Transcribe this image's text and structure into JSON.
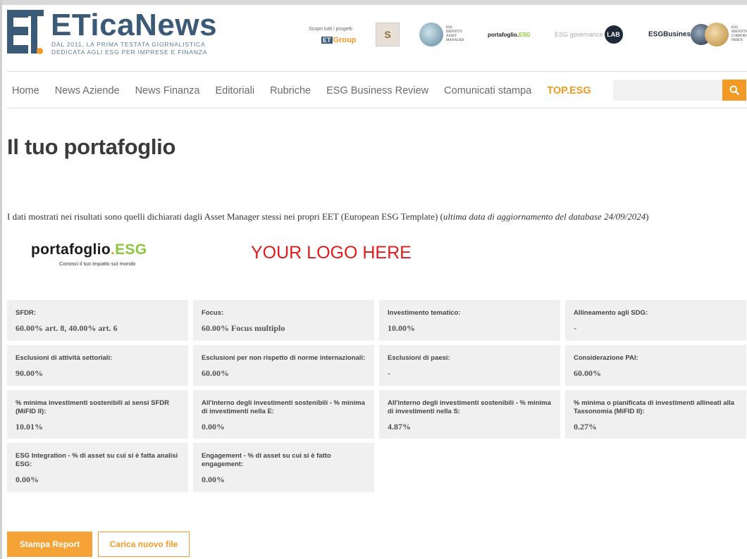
{
  "header": {
    "brand": "ETicaNews",
    "tagline_line1": "DAL 2011, LA PRIMA TESTATA GIORNALISTICA",
    "tagline_line2": "DEDICATA AGLI ESG PER IMPRESE E FINANZA",
    "partners_caption": "Scopri tutti i progetti",
    "etgroup_mark": "ET",
    "etgroup_text": "Group",
    "partner_portafoglio_prefix": "portafoglio.",
    "partner_portafoglio_suffix": "ESG",
    "partner_governance_text": "ESG governance",
    "partner_governance_lab": "LAB",
    "partner_esgbusiness": "ESGBusiness"
  },
  "nav": {
    "items": [
      "Home",
      "News Aziende",
      "News Finanza",
      "Editoriali",
      "Rubriche",
      "ESG Business Review",
      "Comunicati stampa",
      "TOP.ESG"
    ]
  },
  "search": {
    "placeholder": ""
  },
  "main": {
    "title": "Il tuo portafoglio",
    "intro_text": "I dati mostrati nei risultati sono quelli dichiarati dagli Asset Manager stessi nei propri EET (European ESG Template) (",
    "intro_italic": "ultima data di aggiornamento del database 24/09/2024",
    "intro_end": ")",
    "pf_logo_name": "portafoglio",
    "pf_logo_dot": ".",
    "pf_logo_esg": "ESG",
    "pf_logo_sub": "Conosci il tuo impatto sul mondo",
    "your_logo": "YOUR LOGO HERE"
  },
  "cards": [
    {
      "label": "SFDR:",
      "value": "60.00% art. 8, 40.00% art. 6"
    },
    {
      "label": "Focus:",
      "value": "60.00% Focus multiplo"
    },
    {
      "label": "Investimento tematico:",
      "value": "10.00%"
    },
    {
      "label": "Allineamento agli SDG:",
      "value": "-"
    },
    {
      "label": "Esclusioni di attività settoriali:",
      "value": "90.00%"
    },
    {
      "label": "Esclusioni per non rispetto di norme internazionali:",
      "value": "60.00%"
    },
    {
      "label": "Esclusioni di paesi:",
      "value": "-"
    },
    {
      "label": "Considerazione PAI:",
      "value": "60.00%"
    },
    {
      "label": "% minima investimenti sostenibili ai sensi SFDR (MiFID II):",
      "value": "10.01%"
    },
    {
      "label": "All'interno degli investimenti sostenibili - % minima di investimenti nella E:",
      "value": "0.00%"
    },
    {
      "label": "All'interno degli investimenti sostenibili - % minima di investimenti nella S:",
      "value": "4.87%"
    },
    {
      "label": "% minima o pianificata di investimenti allineati alla Tassonomia (MiFID II):",
      "value": "0.27%"
    },
    {
      "label": "ESG Integration - % di asset su cui si è fatta analisi ESG:",
      "value": "0.00%"
    },
    {
      "label": "Engagement - % di asset su cui si è fatto engagement:",
      "value": "0.00%"
    }
  ],
  "actions": {
    "print_label": "Stampa Report",
    "upload_label": "Carica nuovo file"
  },
  "colors": {
    "accent": "#f39a25",
    "brand": "#3a5a78",
    "esg_green": "#8cc63f",
    "logo_placeholder": "#e01b1b"
  }
}
